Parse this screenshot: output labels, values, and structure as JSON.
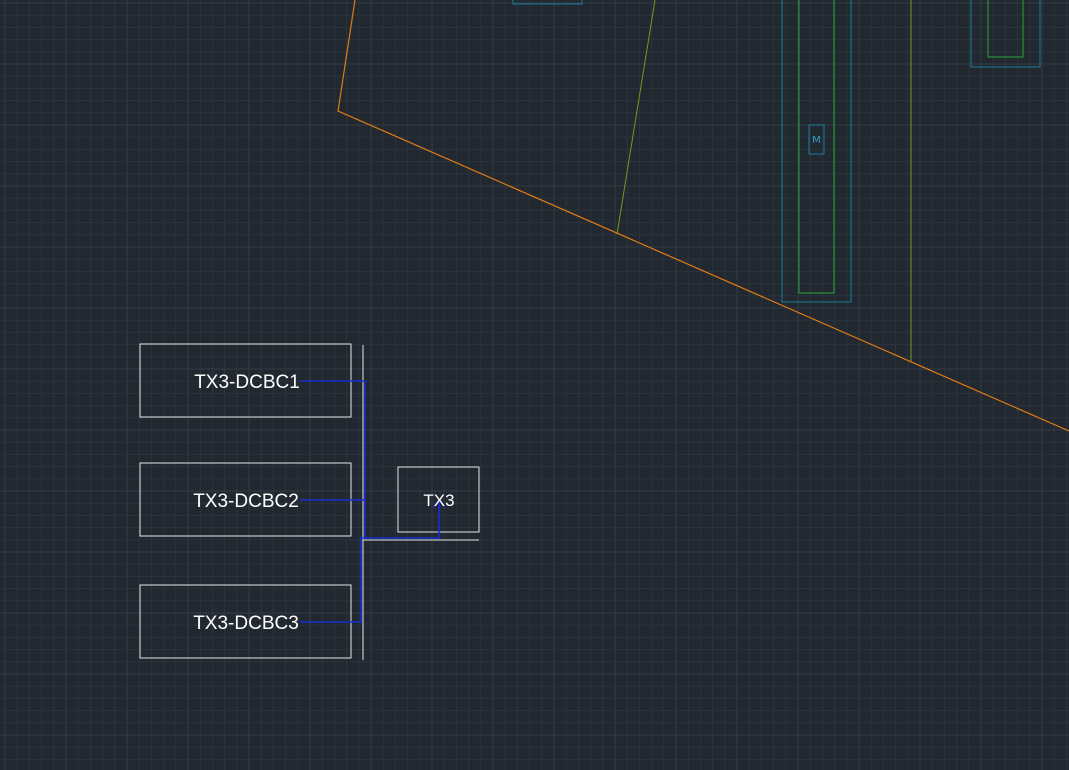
{
  "drawing": {
    "blocks": [
      {
        "id": "dcbc1",
        "label": "TX3-DCBC1"
      },
      {
        "id": "dcbc2",
        "label": "TX3-DCBC2"
      },
      {
        "id": "dcbc3",
        "label": "TX3-DCBC3"
      }
    ],
    "transformer": {
      "label": "TX3"
    },
    "marker": {
      "label": "M"
    }
  },
  "colors": {
    "background": "#212830",
    "grid_minor": "#2b333c",
    "grid_major": "#333c46",
    "outline_white": "#e6e6e6",
    "wire_blue": "#1a2cd4",
    "boundary_orange": "#e07b16",
    "line_green_yellow": "#6f9a1c",
    "cyan_outline": "#1f7d9c",
    "green_outline": "#2aa53a"
  }
}
